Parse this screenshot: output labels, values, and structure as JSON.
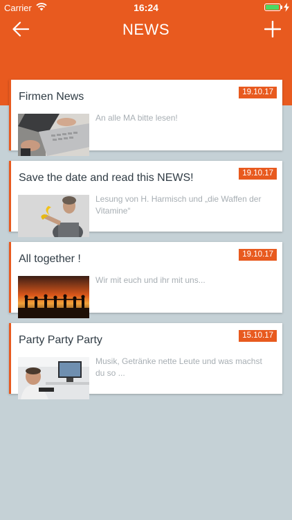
{
  "status_bar": {
    "carrier": "Carrier",
    "time": "16:24",
    "battery_level": 0.95,
    "battery_color": "#4cd964"
  },
  "navbar": {
    "title": "NEWS",
    "back_icon": "arrow-left-icon",
    "add_icon": "plus-icon"
  },
  "colors": {
    "accent": "#e85a1f",
    "background": "#c5d1d6",
    "title_text": "#2f3b44",
    "body_text": "#a7aeb3"
  },
  "news": [
    {
      "title": "Firmen News",
      "date": "19.10.17",
      "text": "An alle MA bitte lesen!",
      "thumb": "laptop-typing-photo"
    },
    {
      "title": "Save the date and read this NEWS!",
      "date": "19.10.17",
      "text": "Lesung von H. Harmisch und „die Waffen der Vitamine“",
      "thumb": "man-with-banana-photo"
    },
    {
      "title": "All together !",
      "date": "19.10.17",
      "text": "Wir mit euch und ihr mit uns...",
      "thumb": "sunset-silhouettes-photo"
    },
    {
      "title": "Party Party Party",
      "date": "15.10.17",
      "text": "Musik, Getränke nette Leute und was machst du so ...",
      "thumb": "office-party-photo"
    }
  ]
}
